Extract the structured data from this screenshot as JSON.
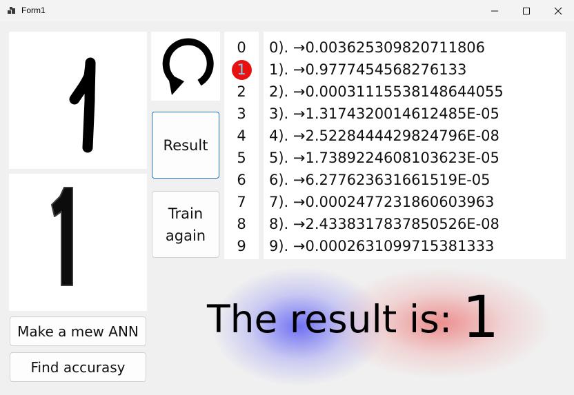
{
  "window": {
    "title": "Form1",
    "controls": {
      "minimize": "minimize-icon",
      "maximize": "maximize-icon",
      "close": "close-icon"
    }
  },
  "canvas": {
    "drawn_digit": "1",
    "preview_digit": "1"
  },
  "buttons": {
    "reset_icon": "refresh-icon",
    "result": "Result",
    "train_again_line1": "Train",
    "train_again_line2": "again",
    "make_new_ann": "Make a mew ANN",
    "find_accuracy": "Find accurasy"
  },
  "digits": [
    "0",
    "1",
    "2",
    "3",
    "4",
    "5",
    "6",
    "7",
    "8",
    "9"
  ],
  "highlighted_digit": "1",
  "outputs": [
    "0). →0.003625309820711806",
    "1). →0.9777454568276133",
    "2). →0.00031115538148644055",
    "3). →1.3174320014612485E-05",
    "4). →2.5228444429824796E-08",
    "5). →1.7389224608103623E-05",
    "6). →6.277623631661519E-05",
    "7). →0.0002477231860603963",
    "8). →2.4338317837850526E-08",
    "9). →0.0002631099715381333"
  ],
  "result": {
    "label": "The result is:",
    "value": "1"
  },
  "colors": {
    "highlight": "#e81010",
    "highlight_text": "#7fd6f0",
    "glow_blue": "#4646f5",
    "glow_red": "#eb6e6e"
  }
}
